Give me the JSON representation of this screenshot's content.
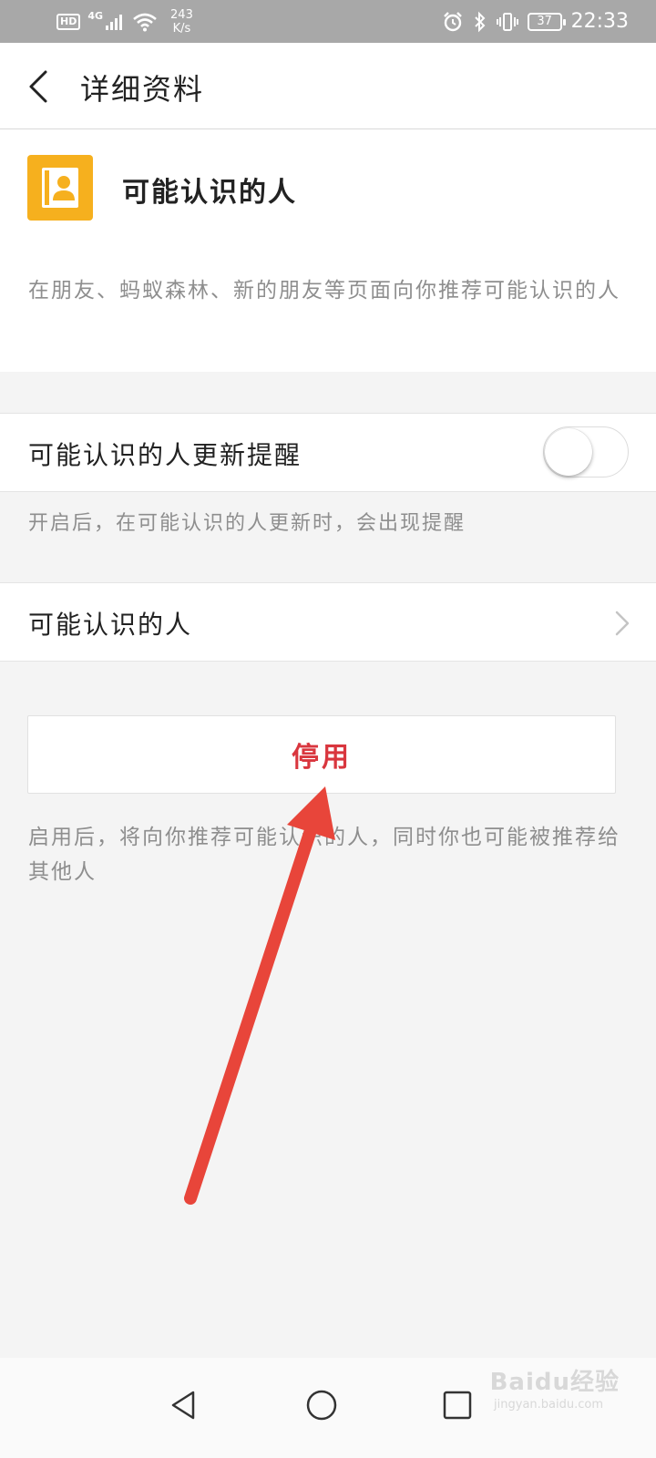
{
  "status_bar": {
    "hd": "HD",
    "network": "4G",
    "speed_value": "243",
    "speed_unit": "K/s",
    "battery": "37",
    "time": "22:33"
  },
  "header": {
    "title": "详细资料"
  },
  "info": {
    "title": "可能认识的人",
    "description": "在朋友、蚂蚁森林、新的朋友等页面向你推荐可能认识的人"
  },
  "settings": {
    "reminder_label": "可能认识的人更新提醒",
    "reminder_enabled": false,
    "reminder_hint": "开启后，在可能认识的人更新时，会出现提醒",
    "people_label": "可能认识的人"
  },
  "disable": {
    "label": "停用",
    "hint": "启用后，将向你推荐可能认识的人，同时你也可能被推荐给其他人"
  },
  "watermark": {
    "brand": "Baidu经验",
    "url": "jingyan.baidu.com"
  },
  "colors": {
    "accent_icon": "#f6b01e",
    "danger_text": "#d9363e",
    "annotation_arrow": "#e8453a",
    "status_bar_bg": "#a8a8a8",
    "page_bg": "#f4f4f4"
  }
}
